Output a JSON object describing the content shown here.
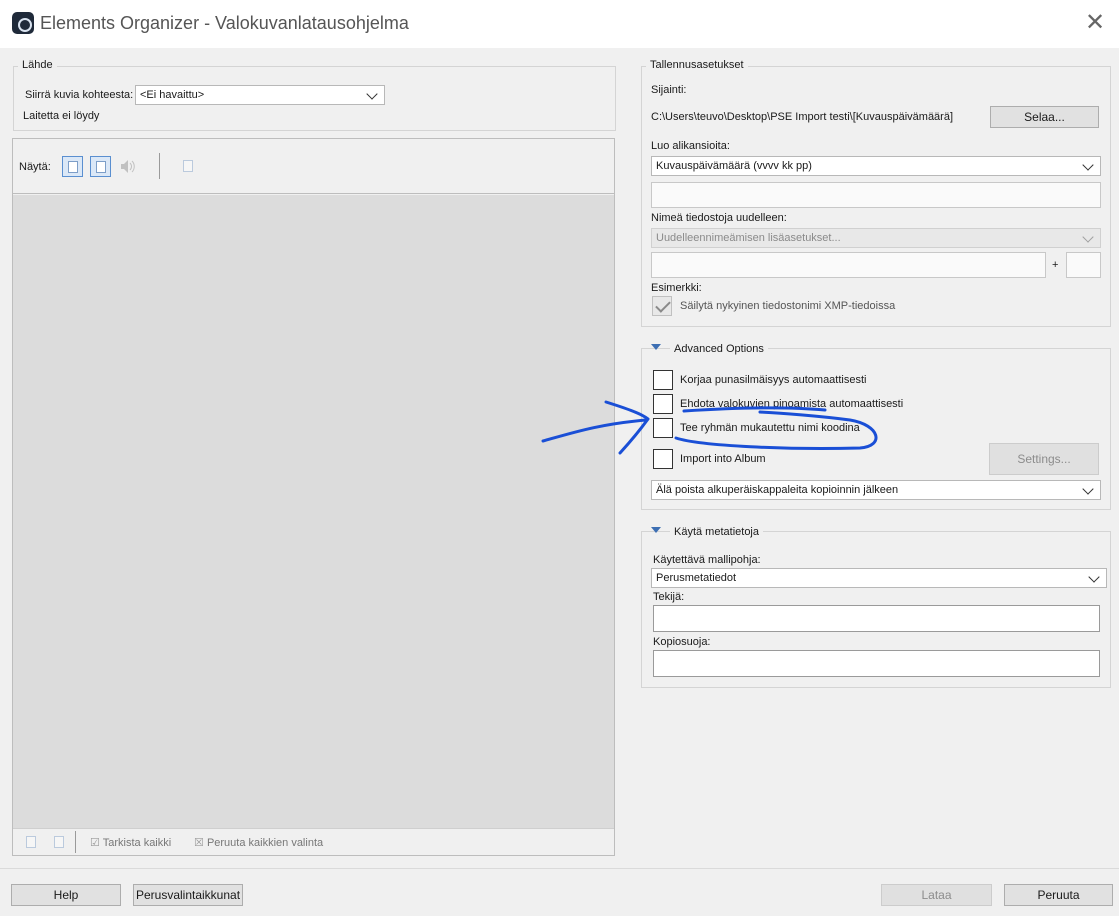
{
  "window": {
    "title": "Elements Organizer - Valokuvanlatausohjelma",
    "close_glyph": "✕"
  },
  "source": {
    "group_label": "Lähde",
    "get_from_label": "Siirrä kuvia kohteesta:",
    "get_from_value": "<Ei havaittu>",
    "device_status": "Laitetta ei löydy",
    "show_label": "Näytä:",
    "check_all": "Tarkista kaikki",
    "uncheck_all": "Peruuta kaikkien valinta"
  },
  "save": {
    "group_label": "Tallennusasetukset",
    "location_label": "Sijainti:",
    "location_path": "C:\\Users\\teuvo\\Desktop\\PSE Import testi\\[Kuvauspäivämäärä]",
    "browse_button": "Selaa...",
    "subfolders_label": "Luo alikansioita:",
    "subfolders_value": "Kuvauspäivämäärä (vvvv kk pp)",
    "rename_label": "Nimeä tiedostoja uudelleen:",
    "rename_value": "Uudelleennimeämisen lisäasetukset...",
    "plus_sign": "+",
    "example_label": "Esimerkki:",
    "preserve_xmp_label": "Säilytä nykyinen tiedostonimi XMP-tiedoissa"
  },
  "advanced": {
    "group_label": "Advanced Options",
    "options": [
      {
        "label": "Korjaa punasilmäisyys automaattisesti"
      },
      {
        "label": "Ehdota valokuvien pinoamista automaattisesti"
      },
      {
        "label": "Tee ryhmän mukautettu nimi koodina"
      },
      {
        "label": "Import into Album"
      }
    ],
    "settings_button": "Settings...",
    "after_copy_value": "Älä poista alkuperäiskappaleita kopioinnin jälkeen"
  },
  "metadata": {
    "group_label": "Käytä metatietoja",
    "template_label": "Käytettävä mallipohja:",
    "template_value": "Perusmetatiedot",
    "author_label": "Tekijä:",
    "copyright_label": "Kopiosuoja:"
  },
  "footer": {
    "help_button": "Help",
    "standard_dialog_button": "Perusvalintaikkunat",
    "get_media_button": "Lataa",
    "cancel_button": "Peruuta"
  },
  "colors": {
    "annotation_ink": "#1a4fd6",
    "section_triangle": "#3d6fb3"
  }
}
